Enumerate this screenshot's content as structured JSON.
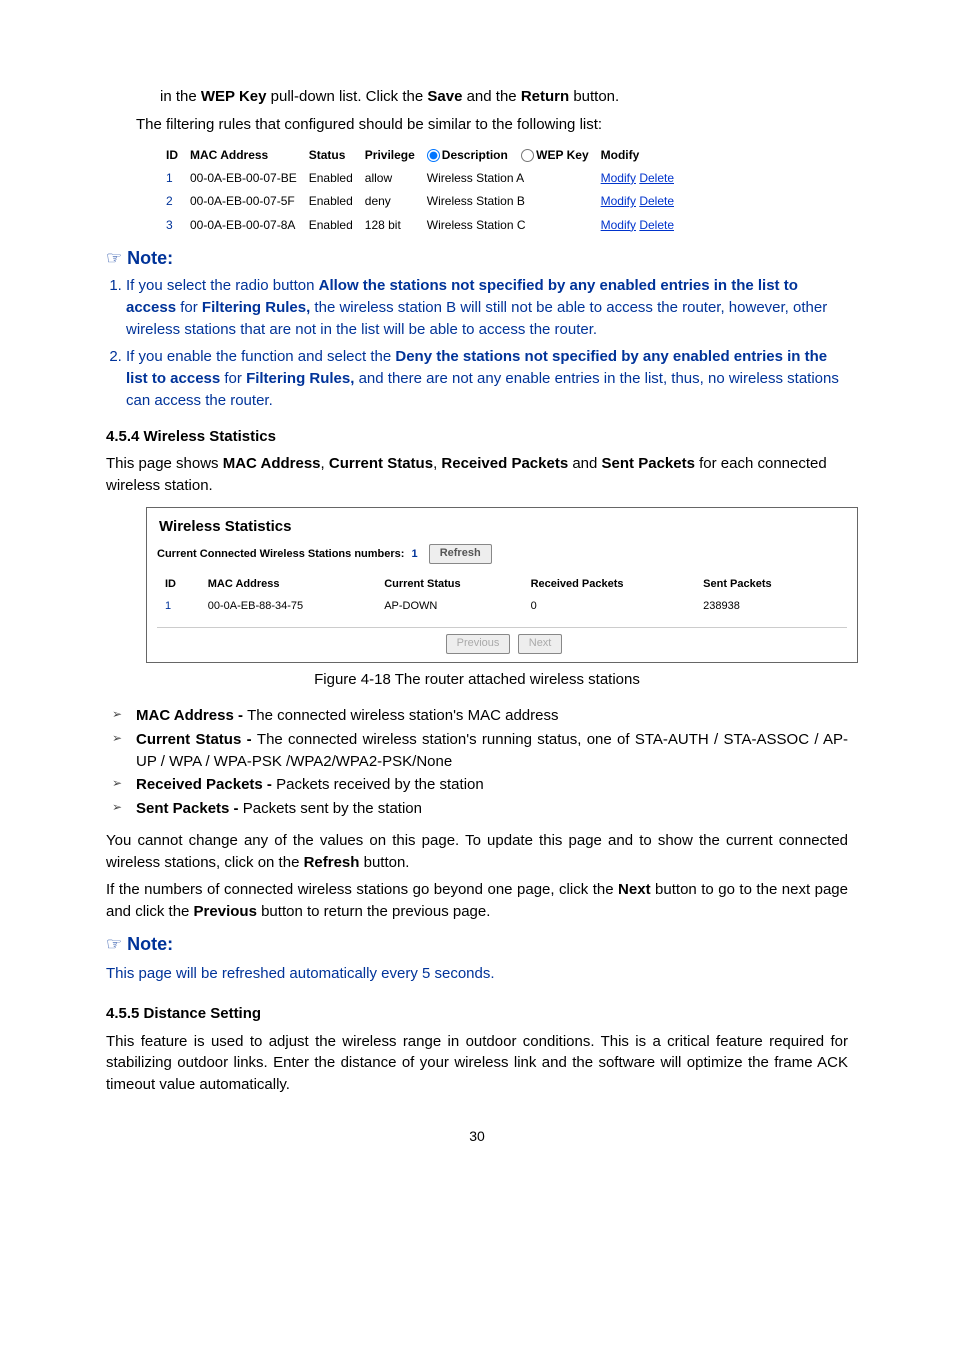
{
  "step_line": {
    "pre": "in the ",
    "bold1": "WEP Key",
    "mid1": " pull-down list. Click the ",
    "bold2": "Save",
    "mid2": " and the ",
    "bold3": "Return",
    "post": " button."
  },
  "filtering_intro": "The filtering rules that configured should be similar to the following list:",
  "filter_table": {
    "headers": [
      "ID",
      "MAC Address",
      "Status",
      "Privilege",
      "Description",
      "WEP Key",
      "Modify"
    ],
    "radio_desc_label": "Description",
    "radio_wep_label": "WEP Key",
    "rows": [
      {
        "id": "1",
        "mac": "00-0A-EB-00-07-BE",
        "status": "Enabled",
        "priv": "allow",
        "desc": "Wireless Station A",
        "modify": "Modify",
        "delete": "Delete"
      },
      {
        "id": "2",
        "mac": "00-0A-EB-00-07-5F",
        "status": "Enabled",
        "priv": "deny",
        "desc": "Wireless Station B",
        "modify": "Modify",
        "delete": "Delete"
      },
      {
        "id": "3",
        "mac": "00-0A-EB-00-07-8A",
        "status": "Enabled",
        "priv": "128 bit",
        "desc": "Wireless Station C",
        "modify": "Modify",
        "delete": "Delete"
      }
    ]
  },
  "note_label": "Note:",
  "notes": {
    "n1_a": "If you select the radio button ",
    "n1_b": "Allow the stations not specified by any enabled entries in the list to access",
    "n1_c": " for ",
    "n1_d": "Filtering Rules,",
    "n1_e": " the wireless station B will still not be able to access the router, however, other wireless stations that are not in the list will be able to access the router.",
    "n2_a": "If you enable the function and select the ",
    "n2_b": "Deny the stations not specified by any enabled entries in the list to access",
    "n2_c": " for ",
    "n2_d": "Filtering Rules,",
    "n2_e": " and there are not any enable entries in the list, thus, no wireless stations can access the router."
  },
  "section_stats": "4.5.4  Wireless Statistics",
  "stats_intro": {
    "pre": "This page shows ",
    "b1": "MAC Address",
    "c1": ", ",
    "b2": "Current Status",
    "c2": ", ",
    "b3": "Received Packets",
    "c3": " and ",
    "b4": "Sent Packets",
    "post": " for each connected wireless station."
  },
  "stats_panel": {
    "title": "Wireless Statistics",
    "sub": "Current Connected Wireless Stations numbers:",
    "count": "1",
    "refresh": "Refresh",
    "headers": [
      "ID",
      "MAC Address",
      "Current Status",
      "Received Packets",
      "Sent Packets"
    ],
    "row": {
      "id": "1",
      "mac": "00-0A-EB-88-34-75",
      "status": "AP-DOWN",
      "recv": "0",
      "sent": "238938"
    },
    "prev": "Previous",
    "next": "Next"
  },
  "fig_caption": "Figure 4-18 The router attached wireless stations",
  "bullets": {
    "b1_bold": "MAC Address - ",
    "b1_txt": "The connected wireless station's MAC address",
    "b2_bold": "Current Status - ",
    "b2_txt": "The connected wireless station's running status, one of STA-AUTH / STA-ASSOC / AP-UP / WPA / WPA-PSK /WPA2/WPA2-PSK/None",
    "b3_bold": "Received Packets - ",
    "b3_txt": "Packets received by the station",
    "b4_bold": "Sent Packets - ",
    "b4_txt": "Packets sent by the station"
  },
  "cannot_change": {
    "pre": "You cannot change any of the values on this page. To update this page and to show the current connected wireless stations, click on the ",
    "b": "Refresh",
    "post": " button."
  },
  "paging": {
    "pre": "If the numbers of connected wireless stations go beyond one page, click the ",
    "b1": "Next",
    "mid": " button to go to the next page and click the ",
    "b2": "Previous",
    "post": " button to return the previous page."
  },
  "auto_refresh": "This page will be refreshed automatically every 5 seconds.",
  "section_dist": "4.5.5  Distance Setting",
  "dist_para": "This feature is used to adjust the wireless range in outdoor conditions. This is a critical feature required for stabilizing outdoor links. Enter the distance of your wireless link and the software will optimize the frame ACK timeout value automatically.",
  "page_number": "30"
}
